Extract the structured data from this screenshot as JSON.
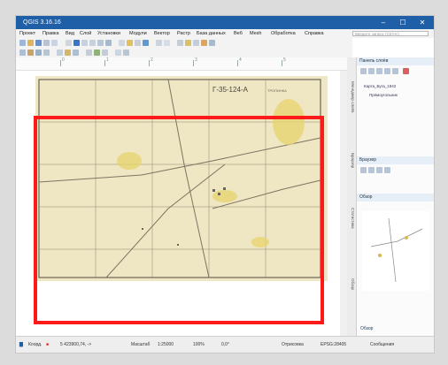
{
  "window": {
    "title": "QGIS 3.16.16",
    "controls": [
      "–",
      "☐",
      "✕"
    ]
  },
  "menubar": {
    "items": [
      "Проект",
      "Правка",
      "Вид",
      "Слой",
      "Установки",
      "Модули",
      "Вектор",
      "Растр",
      "База данных",
      "Веб",
      "Mesh",
      "Обработка",
      "Справка"
    ],
    "search_placeholder": "Введите запрос (Ctrl+K)"
  },
  "ruler": {
    "ticks": [
      "0",
      "1",
      "2",
      "3",
      "4",
      "5"
    ]
  },
  "map_sheet": {
    "nomenclature": "Г-35-124-А",
    "label_right": "ТРОПИНКА"
  },
  "panels": {
    "layers": {
      "title": "Панель слоёв",
      "items": [
        "Карта_Буга_1942",
        "Прямоугольник"
      ]
    },
    "browser": {
      "title": "Браузер"
    },
    "third": {
      "title": "Обзор"
    }
  },
  "sidetabs": [
    "Менеджер слоёв",
    "Браузер",
    "Статистика",
    "Обзор"
  ],
  "statusbar": {
    "coord_label": "Коорд.",
    "coordinates": "5 423900,74, ->",
    "scale_label": "Масштаб",
    "scale": "1:25000",
    "magnifier": "100%",
    "rotation": "0,0°",
    "render": "Отрисовка",
    "crs": "EPSG:28405",
    "messages": "Сообщения"
  },
  "colors": {
    "titlebar": "#1f5fa8",
    "highlight": "#ff1a1a",
    "map_paper": "#efe6c4"
  }
}
